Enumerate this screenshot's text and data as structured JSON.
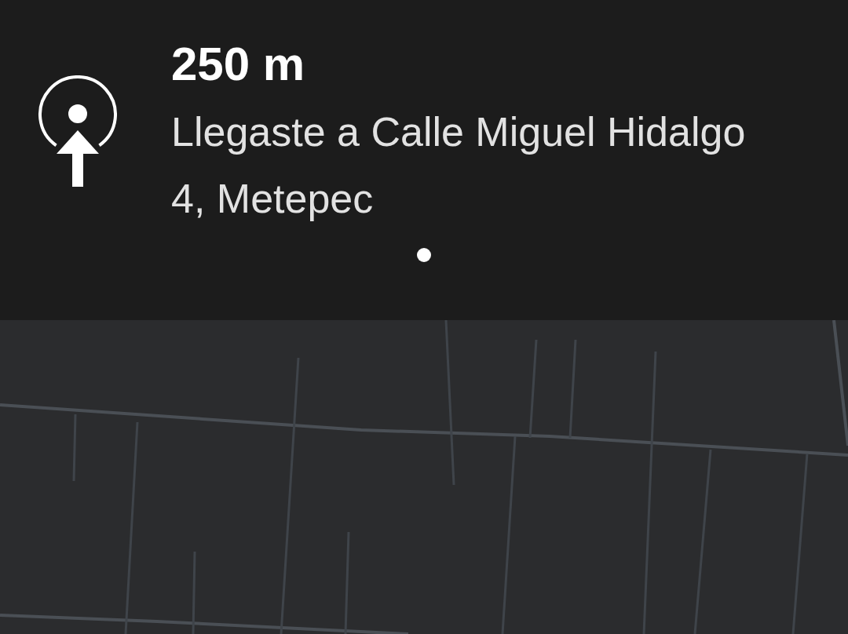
{
  "maneuver": {
    "distance": "250 m",
    "instruction": "Llegaste a Calle Miguel Hidalgo 4, Metepec"
  },
  "pager": [
    {
      "selected": true
    }
  ]
}
